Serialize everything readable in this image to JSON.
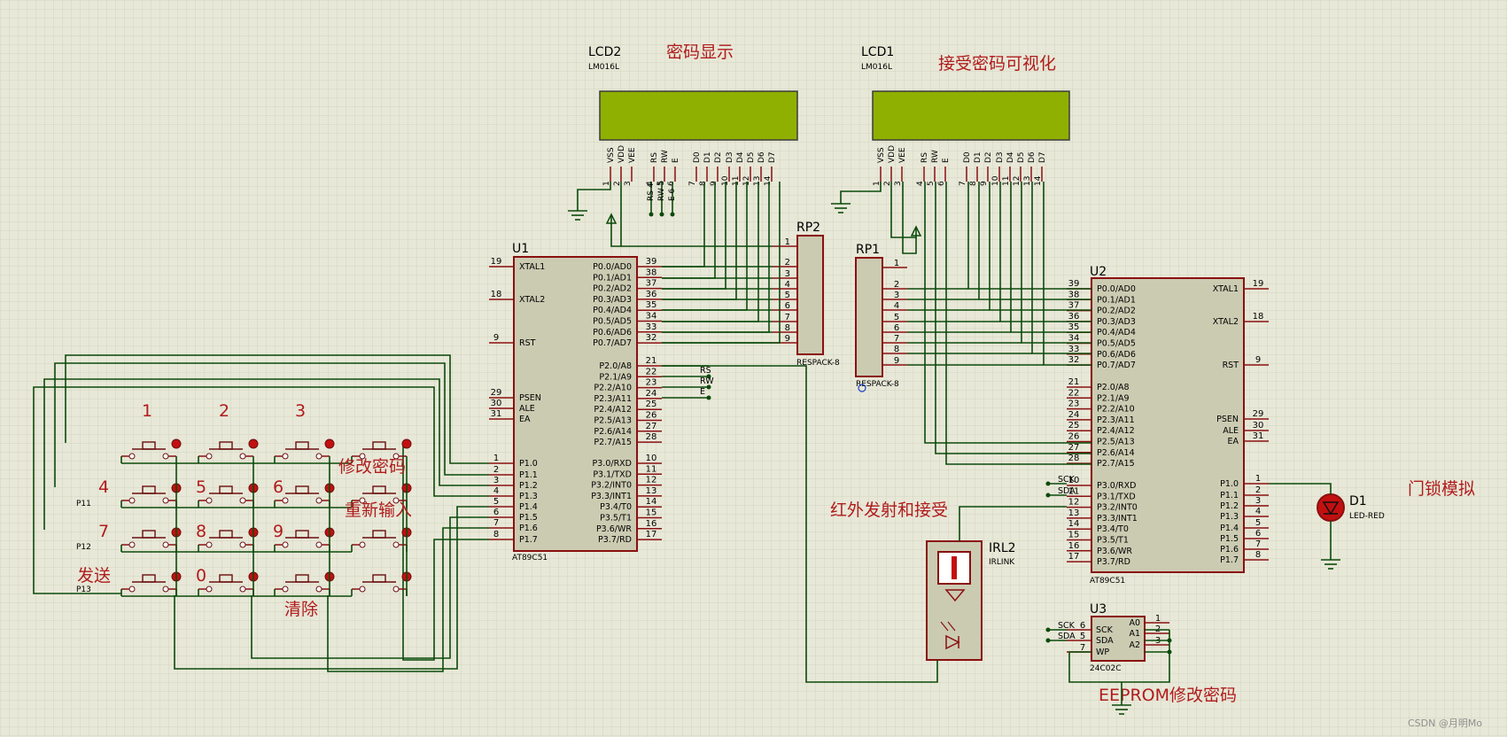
{
  "labels": {
    "lcd2_ref": "LCD2",
    "lcd2_model": "LM016L",
    "lcd2_title": "密码显示",
    "lcd1_ref": "LCD1",
    "lcd1_model": "LM016L",
    "lcd1_title": "接受密码可视化",
    "u1_ref": "U1",
    "u1_model": "AT89C51",
    "u2_ref": "U2",
    "u2_model": "AT89C51",
    "u3_ref": "U3",
    "u3_model": "24C02C",
    "rp2_ref": "RP2",
    "rp2_model": "RESPACK-8",
    "rp1_ref": "RP1",
    "rp1_model": "RESPACK-8",
    "irl_ref": "IRL2",
    "irl_model": "IRLINK",
    "d1_ref": "D1",
    "d1_model": "LED-RED",
    "lock_title": "门锁模拟",
    "ir_title": "红外发射和接受",
    "eeprom_title": "EEPROM修改密码",
    "key_1": "1",
    "key_2": "2",
    "key_3": "3",
    "key_4": "4",
    "key_5": "5",
    "key_6": "6",
    "key_7": "7",
    "key_8": "8",
    "key_9": "9",
    "key_send": "发送",
    "key_0": "0",
    "key_clear": "清除",
    "key_modify": "修改密码",
    "key_reenter": "重新输入",
    "row_p11": "P11",
    "row_p12": "P12",
    "row_p13": "P13",
    "rs_net": "RS",
    "rw_net": "RW",
    "e_net": "E",
    "sck_net": "SCK",
    "sda_net": "SDA",
    "watermark": "CSDN @月明Mo"
  },
  "lcd_pins": [
    "VSS",
    "VDD",
    "VEE",
    "RS",
    "RW",
    "E",
    "D0",
    "D1",
    "D2",
    "D3",
    "D4",
    "D5",
    "D6",
    "D7"
  ],
  "lcd_pin_numbers": [
    "1",
    "2",
    "3",
    "4",
    "5",
    "6",
    "7",
    "8",
    "9",
    "10",
    "11",
    "12",
    "13",
    "14"
  ],
  "lcd2_stub_labels": [
    "RS 4",
    "RW 5",
    "E 6"
  ],
  "u1_left": [
    {
      "num": "19",
      "name": "XTAL1"
    },
    {
      "num": "18",
      "name": "XTAL2"
    },
    {
      "num": "9",
      "name": "RST"
    },
    {
      "num": "29",
      "name": "PSEN"
    },
    {
      "num": "30",
      "name": "ALE"
    },
    {
      "num": "31",
      "name": "EA"
    },
    {
      "num": "1",
      "name": "P1.0"
    },
    {
      "num": "2",
      "name": "P1.1"
    },
    {
      "num": "3",
      "name": "P1.2"
    },
    {
      "num": "4",
      "name": "P1.3"
    },
    {
      "num": "5",
      "name": "P1.4"
    },
    {
      "num": "6",
      "name": "P1.5"
    },
    {
      "num": "7",
      "name": "P1.6"
    },
    {
      "num": "8",
      "name": "P1.7"
    }
  ],
  "u1_right": [
    {
      "num": "39",
      "name": "P0.0/AD0"
    },
    {
      "num": "38",
      "name": "P0.1/AD1"
    },
    {
      "num": "37",
      "name": "P0.2/AD2"
    },
    {
      "num": "36",
      "name": "P0.3/AD3"
    },
    {
      "num": "35",
      "name": "P0.4/AD4"
    },
    {
      "num": "34",
      "name": "P0.5/AD5"
    },
    {
      "num": "33",
      "name": "P0.6/AD6"
    },
    {
      "num": "32",
      "name": "P0.7/AD7"
    },
    {
      "num": "21",
      "name": "P2.0/A8"
    },
    {
      "num": "22",
      "name": "P2.1/A9"
    },
    {
      "num": "23",
      "name": "P2.2/A10"
    },
    {
      "num": "24",
      "name": "P2.3/A11"
    },
    {
      "num": "25",
      "name": "P2.4/A12"
    },
    {
      "num": "26",
      "name": "P2.5/A13"
    },
    {
      "num": "27",
      "name": "P2.6/A14"
    },
    {
      "num": "28",
      "name": "P2.7/A15"
    },
    {
      "num": "10",
      "name": "P3.0/RXD"
    },
    {
      "num": "11",
      "name": "P3.1/TXD"
    },
    {
      "num": "12",
      "name": "P3.2/INT0"
    },
    {
      "num": "13",
      "name": "P3.3/INT1"
    },
    {
      "num": "14",
      "name": "P3.4/T0"
    },
    {
      "num": "15",
      "name": "P3.5/T1"
    },
    {
      "num": "16",
      "name": "P3.6/WR"
    },
    {
      "num": "17",
      "name": "P3.7/RD"
    }
  ],
  "u2_left": [
    {
      "num": "39",
      "name": "P0.0/AD0"
    },
    {
      "num": "38",
      "name": "P0.1/AD1"
    },
    {
      "num": "37",
      "name": "P0.2/AD2"
    },
    {
      "num": "36",
      "name": "P0.3/AD3"
    },
    {
      "num": "35",
      "name": "P0.4/AD4"
    },
    {
      "num": "34",
      "name": "P0.5/AD5"
    },
    {
      "num": "33",
      "name": "P0.6/AD6"
    },
    {
      "num": "32",
      "name": "P0.7/AD7"
    },
    {
      "num": "21",
      "name": "P2.0/A8"
    },
    {
      "num": "22",
      "name": "P2.1/A9"
    },
    {
      "num": "23",
      "name": "P2.2/A10"
    },
    {
      "num": "24",
      "name": "P2.3/A11"
    },
    {
      "num": "25",
      "name": "P2.4/A12"
    },
    {
      "num": "26",
      "name": "P2.5/A13"
    },
    {
      "num": "27",
      "name": "P2.6/A14"
    },
    {
      "num": "28",
      "name": "P2.7/A15"
    },
    {
      "num": "10",
      "name": "P3.0/RXD"
    },
    {
      "num": "11",
      "name": "P3.1/TXD"
    },
    {
      "num": "12",
      "name": "P3.2/INT0"
    },
    {
      "num": "13",
      "name": "P3.3/INT1"
    },
    {
      "num": "14",
      "name": "P3.4/T0"
    },
    {
      "num": "15",
      "name": "P3.5/T1"
    },
    {
      "num": "16",
      "name": "P3.6/WR"
    },
    {
      "num": "17",
      "name": "P3.7/RD"
    }
  ],
  "u2_right": [
    {
      "num": "19",
      "name": "XTAL1"
    },
    {
      "num": "18",
      "name": "XTAL2"
    },
    {
      "num": "9",
      "name": "RST"
    },
    {
      "num": "29",
      "name": "PSEN"
    },
    {
      "num": "30",
      "name": "ALE"
    },
    {
      "num": "31",
      "name": "EA"
    },
    {
      "num": "1",
      "name": "P1.0"
    },
    {
      "num": "2",
      "name": "P1.1"
    },
    {
      "num": "3",
      "name": "P1.2"
    },
    {
      "num": "4",
      "name": "P1.3"
    },
    {
      "num": "5",
      "name": "P1.4"
    },
    {
      "num": "6",
      "name": "P1.5"
    },
    {
      "num": "7",
      "name": "P1.6"
    },
    {
      "num": "8",
      "name": "P1.7"
    }
  ],
  "rp_pins": [
    "1",
    "2",
    "3",
    "4",
    "5",
    "6",
    "7",
    "8",
    "9"
  ],
  "u3_left": [
    {
      "num": "6",
      "name": "SCK"
    },
    {
      "num": "5",
      "name": "SDA"
    },
    {
      "num": "7",
      "name": "WP"
    }
  ],
  "u3_right": [
    {
      "num": "1",
      "name": "A0"
    },
    {
      "num": "2",
      "name": "A1"
    },
    {
      "num": "3",
      "name": "A2"
    }
  ],
  "u3_nets": [
    "SCK",
    "SDA"
  ],
  "u2_nets": [
    "SCK",
    "SDA"
  ],
  "colors": {
    "background": "#e8e8d8",
    "grid": "#d3d3c0",
    "wire": "#0b4a0b",
    "pin": "#8a1010",
    "chip_fill": "#cbcbb2",
    "lcd_screen": "#8fb000",
    "label_red": "#b01c1c",
    "led": "#c21010"
  }
}
